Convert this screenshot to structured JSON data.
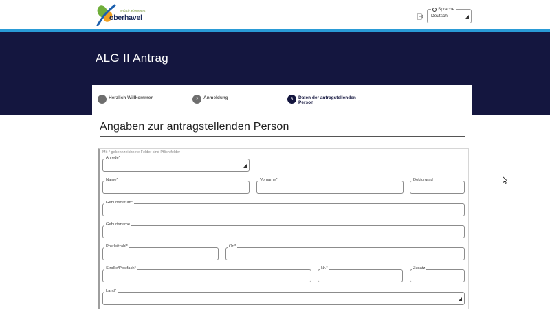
{
  "header": {
    "logo_tagline": "einfach lebenswert",
    "logo_name": "oberhavel",
    "language": {
      "legend": "Sprache",
      "value": "Deutsch"
    }
  },
  "hero": {
    "title": "ALG II Antrag"
  },
  "stepper": {
    "steps": [
      {
        "number": "1",
        "label": "Herzlich Willkommen"
      },
      {
        "number": "2",
        "label": "Anmeldung"
      },
      {
        "number": "3",
        "label_line1": "Daten der antragstellenden",
        "label_line2": "Person"
      }
    ]
  },
  "form": {
    "section_title": "Angaben zur antragstellenden Person",
    "required_hint": "Mit * gekennzeichnete Felder sind Pflichtfelder",
    "fields": {
      "anrede": "Anrede*",
      "name": "Name*",
      "vorname": "Vorname*",
      "doktorgrad": "Doktorgrad",
      "geburtsdatum": "Geburtsdatum*",
      "geburtsname": "Geburtsname",
      "postleitzahl": "Postleitzahl*",
      "ort": "Ort*",
      "strasse": "Straße/Postfach*",
      "nr": "Nr.*",
      "zusatz": "Zusatz",
      "land": "Land*"
    }
  },
  "colors": {
    "hero": "#14163f",
    "stripe": "#2a9bd6",
    "step_active": "#14163f",
    "step_inactive": "#6e6e6e"
  },
  "icons": [
    "logo-mark",
    "login-icon",
    "globe-icon",
    "chevron-down-icon",
    "mouse-cursor-icon"
  ]
}
